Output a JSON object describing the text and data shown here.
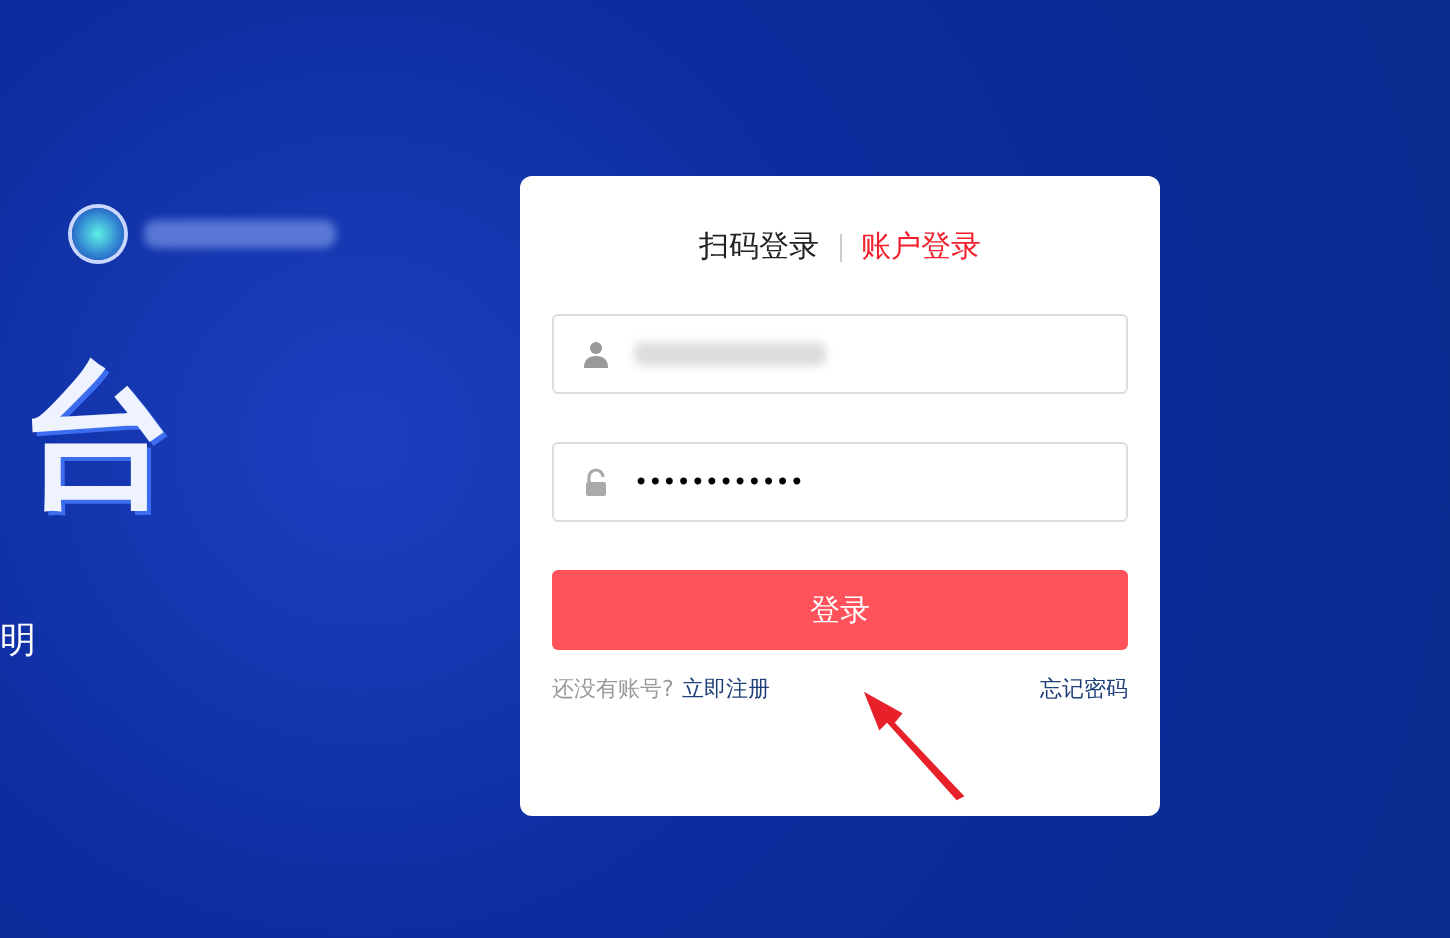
{
  "hero": {
    "title": "台",
    "subtitle": "明"
  },
  "login_card": {
    "tabs": [
      {
        "label": "扫码登录",
        "selected": false
      },
      {
        "label": "账户登录",
        "selected": true
      }
    ],
    "password": {
      "value": "••••••••••••"
    },
    "submit": "登录",
    "register_prompt": "还没有账号?",
    "register_link": "立即注册",
    "forgot_link": "忘记密码"
  }
}
